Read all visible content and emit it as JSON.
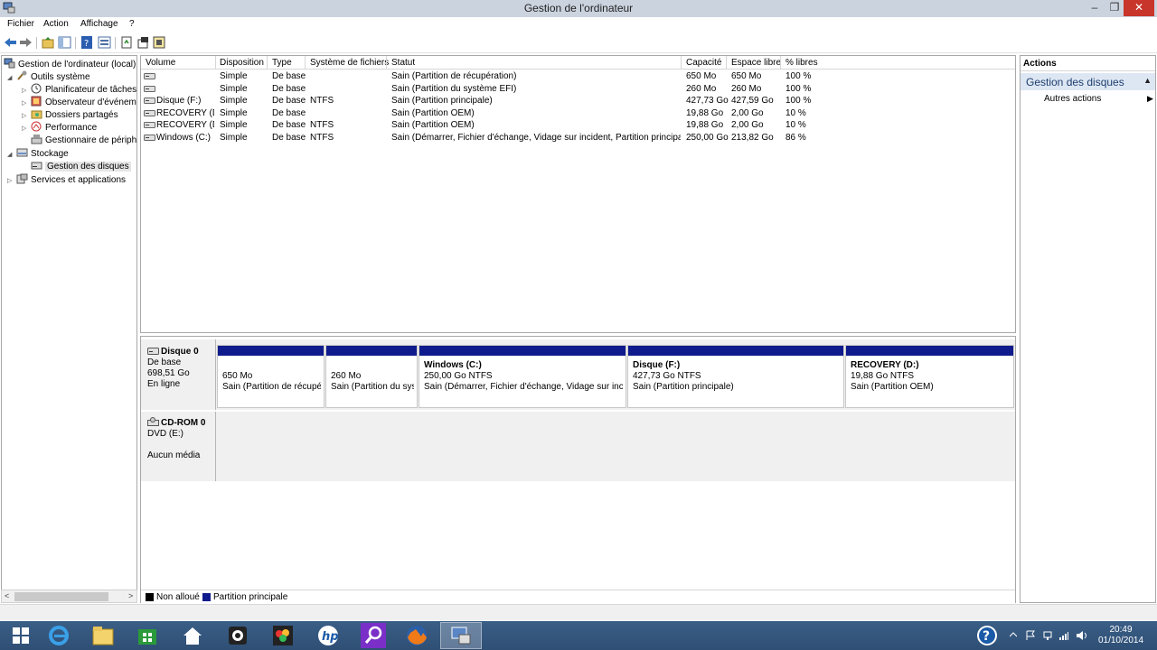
{
  "window": {
    "title": "Gestion de l'ordinateur",
    "minimize": "–",
    "maximize": "❐",
    "close": "✕"
  },
  "menu": {
    "items": [
      "Fichier",
      "Action",
      "Affichage",
      "?"
    ]
  },
  "toolbar": {
    "icons": [
      "back-arrow-icon",
      "forward-arrow-icon",
      "up-folder-icon",
      "show-hide-console-tree-icon",
      "help-icon",
      "view-icon",
      "refresh-icon",
      "properties-icon",
      "settings-icon"
    ]
  },
  "tree": {
    "items": [
      {
        "label": "Gestion de l'ordinateur (local)",
        "icon": "computer-management-icon",
        "arrow": ""
      },
      {
        "label": "Outils système",
        "icon": "system-tools-icon",
        "arrow": "◢"
      },
      {
        "label": "Planificateur de tâches",
        "icon": "task-scheduler-icon",
        "arrow": "▷"
      },
      {
        "label": "Observateur d'événements",
        "icon": "event-viewer-icon",
        "arrow": "▷"
      },
      {
        "label": "Dossiers partagés",
        "icon": "shared-folders-icon",
        "arrow": "▷"
      },
      {
        "label": "Performance",
        "icon": "performance-icon",
        "arrow": "▷"
      },
      {
        "label": "Gestionnaire de périphériques",
        "icon": "device-manager-icon",
        "arrow": ""
      },
      {
        "label": "Stockage",
        "icon": "storage-icon",
        "arrow": "◢"
      },
      {
        "label": "Gestion des disques",
        "icon": "disk-management-icon",
        "arrow": ""
      },
      {
        "label": "Services et applications",
        "icon": "services-icon",
        "arrow": "▷"
      }
    ],
    "scroll_left": "<",
    "scroll_right": ">"
  },
  "volume_list": {
    "columns": [
      "Volume",
      "Disposition",
      "Type",
      "Système de fichiers",
      "Statut",
      "Capacité",
      "Espace libre",
      "% libres"
    ],
    "rows": [
      {
        "volume": "",
        "disposition": "Simple",
        "type": "De base",
        "fs": "",
        "statut": "Sain (Partition de récupération)",
        "capacite": "650 Mo",
        "libre": "650 Mo",
        "pct": "100 %"
      },
      {
        "volume": "",
        "disposition": "Simple",
        "type": "De base",
        "fs": "",
        "statut": "Sain (Partition du système EFI)",
        "capacite": "260 Mo",
        "libre": "260 Mo",
        "pct": "100 %"
      },
      {
        "volume": "Disque (F:)",
        "disposition": "Simple",
        "type": "De base",
        "fs": "NTFS",
        "statut": "Sain (Partition principale)",
        "capacite": "427,73 Go",
        "libre": "427,59 Go",
        "pct": "100 %"
      },
      {
        "volume": "RECOVERY (D:)",
        "disposition": "Simple",
        "type": "De base",
        "fs": "",
        "statut": "Sain (Partition OEM)",
        "capacite": "19,88 Go",
        "libre": "2,00 Go",
        "pct": "10 %"
      },
      {
        "volume": "RECOVERY (D:)",
        "disposition": "Simple",
        "type": "De base",
        "fs": "NTFS",
        "statut": "Sain (Partition OEM)",
        "capacite": "19,88 Go",
        "libre": "2,00 Go",
        "pct": "10 %"
      },
      {
        "volume": "Windows (C:)",
        "disposition": "Simple",
        "type": "De base",
        "fs": "NTFS",
        "statut": "Sain (Démarrer, Fichier d'échange, Vidage sur incident, Partition principale)",
        "capacite": "250,00 Go",
        "libre": "213,82 Go",
        "pct": "86 %"
      }
    ]
  },
  "disks": {
    "disk0": {
      "name": "Disque 0",
      "type": "De base",
      "size": "698,51 Go",
      "state": "En ligne",
      "partitions": [
        {
          "title": "",
          "size": "650 Mo",
          "status": "Sain (Partition de récupér"
        },
        {
          "title": "",
          "size": "260 Mo",
          "status": "Sain (Partition du syst"
        },
        {
          "title": "Windows  (C:)",
          "size": "250,00 Go NTFS",
          "status": "Sain (Démarrer, Fichier d'échange, Vidage sur incide"
        },
        {
          "title": "Disque  (F:)",
          "size": "427,73 Go NTFS",
          "status": "Sain (Partition principale)"
        },
        {
          "title": "RECOVERY  (D:)",
          "size": "19,88 Go NTFS",
          "status": "Sain (Partition OEM)"
        }
      ]
    },
    "cdrom0": {
      "name": "CD-ROM 0",
      "drive": "DVD (E:)",
      "media": "Aucun média"
    }
  },
  "legend": {
    "unallocated": "Non alloué",
    "primary": "Partition principale",
    "unallocated_color": "#000000",
    "primary_color": "#0f1b8c"
  },
  "actions": {
    "header": "Actions",
    "group": "Gestion des disques",
    "group_arrow": "▲",
    "item": "Autres actions",
    "item_arrow": "▶"
  },
  "taskbar": {
    "apps": [
      "windows-start-icon",
      "internet-explorer-icon",
      "file-explorer-icon",
      "store-icon",
      "home-icon",
      "camera-icon",
      "photo-app-icon",
      "hp-icon",
      "search-app-icon",
      "firefox-icon",
      "computer-management-icon"
    ],
    "clock_time": "20:49",
    "clock_date": "01/10/2014"
  }
}
